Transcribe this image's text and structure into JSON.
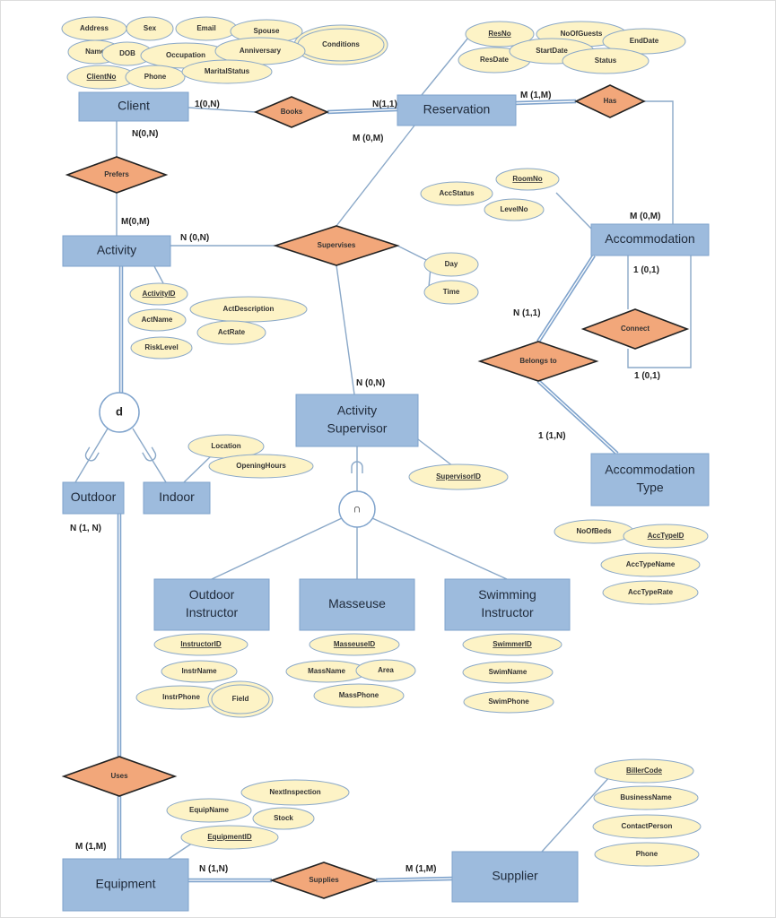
{
  "entities": {
    "client": [
      "Client"
    ],
    "reservation": [
      "Reservation"
    ],
    "activity": [
      "Activity"
    ],
    "accommodation": [
      "Accommodation"
    ],
    "activity_supervisor": [
      "Activity",
      "Supervisor"
    ],
    "outdoor": [
      "Outdoor"
    ],
    "indoor": [
      "Indoor"
    ],
    "accommodation_type": [
      "Accommodation",
      "Type"
    ],
    "outdoor_instructor": [
      "Outdoor",
      "Instructor"
    ],
    "masseuse": [
      "Masseuse"
    ],
    "swimming_instructor": [
      "Swimming",
      "Instructor"
    ],
    "equipment": [
      "Equipment"
    ],
    "supplier": [
      "Supplier"
    ]
  },
  "relationships": {
    "books": "Books",
    "has": "Has",
    "prefers": "Prefers",
    "supervises": "Supervises",
    "connect": "Connect",
    "belongs_to": "Belongs to",
    "uses": "Uses",
    "supplies": "Supplies"
  },
  "attributes": {
    "client": [
      {
        "label": "Address"
      },
      {
        "label": "Sex"
      },
      {
        "label": "Email"
      },
      {
        "label": "Spouse"
      },
      {
        "label": "Conditions",
        "multivalued": true
      },
      {
        "label": "Name"
      },
      {
        "label": "DOB"
      },
      {
        "label": "Occupation"
      },
      {
        "label": "Anniversary"
      },
      {
        "label": "ClientNo",
        "key": true
      },
      {
        "label": "Phone"
      },
      {
        "label": "MaritalStatus"
      }
    ],
    "reservation": [
      {
        "label": "ResNo",
        "key": true
      },
      {
        "label": "NoOfGuests"
      },
      {
        "label": "EndDate"
      },
      {
        "label": "ResDate"
      },
      {
        "label": "StartDate"
      },
      {
        "label": "Status"
      }
    ],
    "accommodation": [
      {
        "label": "RoomNo",
        "key": true
      },
      {
        "label": "AccStatus"
      },
      {
        "label": "LevelNo"
      }
    ],
    "supervises": [
      {
        "label": "Day"
      },
      {
        "label": "Time"
      }
    ],
    "activity": [
      {
        "label": "ActivityID",
        "key": true
      },
      {
        "label": "ActDescription"
      },
      {
        "label": "ActName"
      },
      {
        "label": "ActRate"
      },
      {
        "label": "RiskLevel"
      }
    ],
    "indoor": [
      {
        "label": "Location"
      },
      {
        "label": "OpeningHours"
      }
    ],
    "activity_supervisor": [
      {
        "label": "SupervisorID",
        "key": true
      }
    ],
    "accommodation_type": [
      {
        "label": "NoOfBeds"
      },
      {
        "label": "AccTypeID",
        "key": true
      },
      {
        "label": "AccTypeName"
      },
      {
        "label": "AccTypeRate"
      }
    ],
    "outdoor_instructor": [
      {
        "label": "InstructorID",
        "key": true
      },
      {
        "label": "InstrName"
      },
      {
        "label": "InstrPhone"
      },
      {
        "label": "Field",
        "multivalued": true
      }
    ],
    "masseuse": [
      {
        "label": "MasseuseID",
        "key": true
      },
      {
        "label": "MassName"
      },
      {
        "label": "Area"
      },
      {
        "label": "MassPhone"
      }
    ],
    "swimming_instructor": [
      {
        "label": "SwimmerID",
        "key": true
      },
      {
        "label": "SwimName"
      },
      {
        "label": "SwimPhone"
      }
    ],
    "equipment": [
      {
        "label": "NextInspection"
      },
      {
        "label": "EquipName"
      },
      {
        "label": "Stock"
      },
      {
        "label": "EquipmentID",
        "key": true
      }
    ],
    "supplier": [
      {
        "label": "BillerCode",
        "key": true
      },
      {
        "label": "BusinessName"
      },
      {
        "label": "ContactPerson"
      },
      {
        "label": "Phone"
      }
    ]
  },
  "cardinalities": [
    "1(0,N)",
    "N(1,1)",
    "N(0,N)",
    "M (0,M)",
    "M (1,M)",
    "M(0,M)",
    "N (0,N)",
    "M (0,M)",
    "1 (0,1)",
    "N (1,1)",
    "1 (0,1)",
    "N (0,N)",
    "1 (1,N)",
    "N (1, N)",
    "M (1,M)",
    "N (1,N)",
    "M (1,M)"
  ],
  "specializations": {
    "activity_constraint": "d",
    "supervisor_constraint": "∩"
  },
  "colors": {
    "entity": "#9dbbdd",
    "relationship": "#f2a77a",
    "attribute": "#fdf3c6",
    "line": "#8aa8c8"
  }
}
